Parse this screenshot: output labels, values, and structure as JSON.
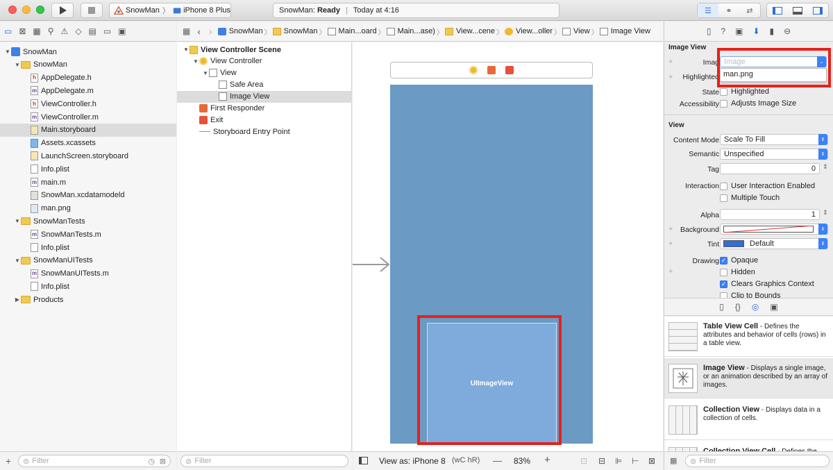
{
  "toolbar": {
    "scheme": "SnowMan",
    "device": "iPhone 8 Plus",
    "status_project": "SnowMan:",
    "status_state": "Ready",
    "status_divider": "|",
    "status_time": "Today at 4:16"
  },
  "navigator": {
    "items": [
      {
        "label": "SnowMan",
        "type": "project",
        "indent": 0,
        "expanded": true
      },
      {
        "label": "SnowMan",
        "type": "folder",
        "indent": 1,
        "expanded": true
      },
      {
        "label": "AppDelegate.h",
        "type": "h",
        "indent": 2
      },
      {
        "label": "AppDelegate.m",
        "type": "m",
        "indent": 2
      },
      {
        "label": "ViewController.h",
        "type": "h",
        "indent": 2
      },
      {
        "label": "ViewController.m",
        "type": "m",
        "indent": 2
      },
      {
        "label": "Main.storyboard",
        "type": "storyboard",
        "indent": 2,
        "selected": true
      },
      {
        "label": "Assets.xcassets",
        "type": "assets",
        "indent": 2
      },
      {
        "label": "LaunchScreen.storyboard",
        "type": "storyboard",
        "indent": 2
      },
      {
        "label": "Info.plist",
        "type": "plist",
        "indent": 2
      },
      {
        "label": "main.m",
        "type": "m",
        "indent": 2
      },
      {
        "label": "SnowMan.xcdatamodeld",
        "type": "datamodel",
        "indent": 2
      },
      {
        "label": "man.png",
        "type": "png",
        "indent": 2
      },
      {
        "label": "SnowManTests",
        "type": "folder",
        "indent": 1,
        "expanded": true
      },
      {
        "label": "SnowManTests.m",
        "type": "m",
        "indent": 2
      },
      {
        "label": "Info.plist",
        "type": "plist",
        "indent": 2
      },
      {
        "label": "SnowManUITests",
        "type": "folder",
        "indent": 1,
        "expanded": true
      },
      {
        "label": "SnowManUITests.m",
        "type": "m",
        "indent": 2
      },
      {
        "label": "Info.plist",
        "type": "plist",
        "indent": 2
      },
      {
        "label": "Products",
        "type": "folder",
        "indent": 1,
        "expanded": false
      }
    ],
    "filter_placeholder": "Filter"
  },
  "jumpbar": {
    "crumbs": [
      "SnowMan",
      "SnowMan",
      "Main...oard",
      "Main...ase)",
      "View...cene",
      "View...oller",
      "View",
      "Image View"
    ]
  },
  "outline": {
    "items": [
      {
        "label": "View Controller Scene",
        "indent": 0,
        "expanded": true,
        "bold": true
      },
      {
        "label": "View Controller",
        "indent": 1,
        "expanded": true
      },
      {
        "label": "View",
        "indent": 2,
        "expanded": true
      },
      {
        "label": "Safe Area",
        "indent": 3
      },
      {
        "label": "Image View",
        "indent": 3,
        "selected": true
      },
      {
        "label": "First Responder",
        "indent": 1
      },
      {
        "label": "Exit",
        "indent": 1
      },
      {
        "label": "Storyboard Entry Point",
        "indent": 1
      }
    ],
    "filter_placeholder": "Filter"
  },
  "canvas": {
    "image_view_label": "UIImageView",
    "view_as": "View as: iPhone 8",
    "size_class": "(wC hR)",
    "zoom_minus": "—",
    "zoom": "83%",
    "zoom_plus": "+"
  },
  "inspector": {
    "image_view_title": "Image View",
    "image_label": "Imag",
    "image_placeholder": "Image",
    "image_dropdown_option": "man.png",
    "highlighted_label": "Highlighted",
    "state_label": "State",
    "state_checkbox": "Highlighted",
    "accessibility_label": "Accessibility",
    "accessibility_checkbox": "Adjusts Image Size",
    "view_title": "View",
    "content_mode_label": "Content Mode",
    "content_mode": "Scale To Fill",
    "semantic_label": "Semantic",
    "semantic": "Unspecified",
    "tag_label": "Tag",
    "tag": "0",
    "interaction_label": "Interaction",
    "user_interaction": "User Interaction Enabled",
    "multiple_touch": "Multiple Touch",
    "alpha_label": "Alpha",
    "alpha": "1",
    "background_label": "Background",
    "tint_label": "Tint",
    "tint": "Default",
    "drawing_label": "Drawing",
    "opaque": "Opaque",
    "hidden": "Hidden",
    "clears_graphics": "Clears Graphics Context",
    "clip_to_bounds": "Clip to Bounds"
  },
  "library": {
    "items": [
      {
        "title": "Table View Cell",
        "desc": " - Defines the attributes and behavior of cells (rows) in a table view."
      },
      {
        "title": "Image View",
        "desc": " - Displays a single image, or an animation described by an array of images.",
        "selected": true
      },
      {
        "title": "Collection View",
        "desc": " - Displays data in a collection of cells."
      },
      {
        "title": "Collection View Cell",
        "desc": " - Defines the"
      }
    ],
    "filter_placeholder": "Filter"
  },
  "colors": {
    "highlight_red": "#e8201a",
    "view_blue": "#6b9ac4",
    "image_view_blue": "#7eabdc",
    "accent": "#3b82f6"
  }
}
